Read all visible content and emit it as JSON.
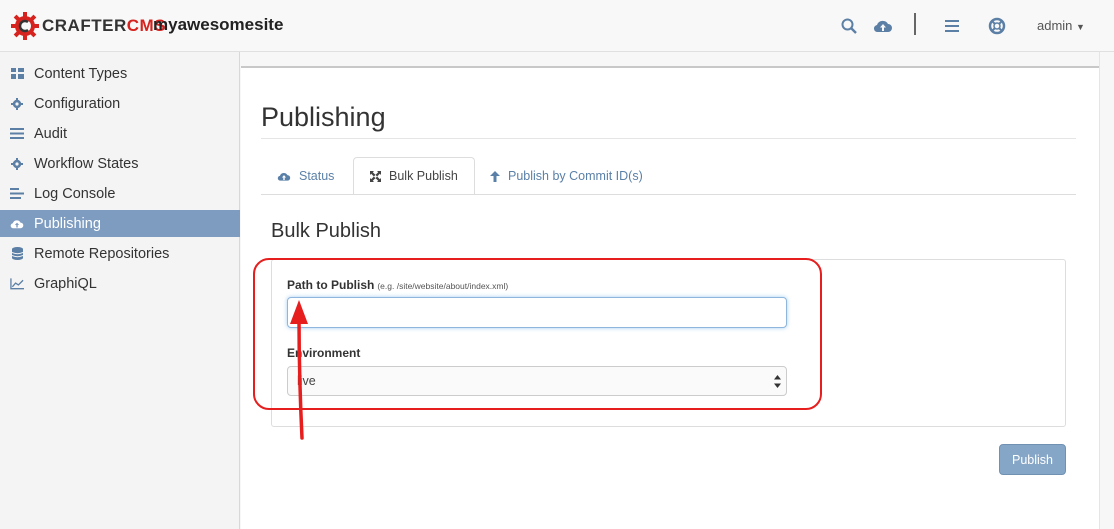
{
  "brand": {
    "part1": "CRAFTER",
    "part2": "CMS",
    "accent": "#d6231f"
  },
  "header": {
    "site_name": "myawesomesite",
    "icons": [
      "search-icon",
      "cloud-upload-icon",
      "menu-icon",
      "help-lifebuoy-icon"
    ],
    "user": "admin"
  },
  "sidebar": {
    "items": [
      {
        "label": "Content Types",
        "icon": "grid-icon"
      },
      {
        "label": "Configuration",
        "icon": "gear-icon"
      },
      {
        "label": "Audit",
        "icon": "list-icon"
      },
      {
        "label": "Workflow States",
        "icon": "gear-icon"
      },
      {
        "label": "Log Console",
        "icon": "align-left-icon"
      },
      {
        "label": "Publishing",
        "icon": "cloud-upload-icon",
        "active": true
      },
      {
        "label": "Remote Repositories",
        "icon": "database-icon"
      },
      {
        "label": "GraphiQL",
        "icon": "line-chart-icon"
      }
    ],
    "active_color": "#7e9cc0"
  },
  "main": {
    "title": "Publishing",
    "tabs": [
      {
        "label": "Status",
        "icon": "cloud-upload-icon"
      },
      {
        "label": "Bulk Publish",
        "icon": "expand-arrows-icon",
        "active": true
      },
      {
        "label": "Publish by Commit ID(s)",
        "icon": "arrow-up-icon"
      }
    ],
    "section_title": "Bulk Publish",
    "form": {
      "path_label": "Path to Publish",
      "path_hint": "(e.g. /site/website/about/index.xml)",
      "path_value": "/",
      "env_label": "Environment",
      "env_value": "live"
    },
    "publish_button": "Publish"
  },
  "annotation": {
    "color": "#e61e1e"
  }
}
